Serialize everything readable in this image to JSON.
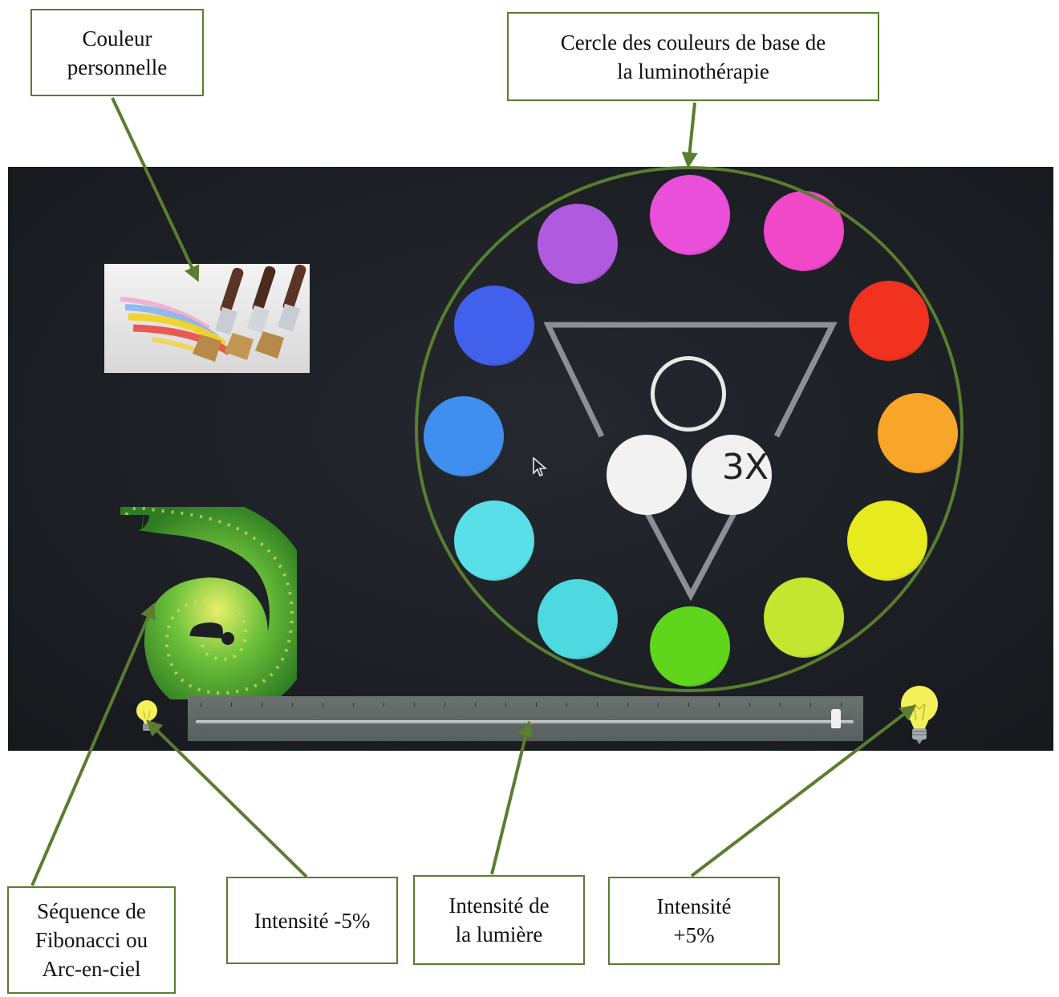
{
  "callouts": {
    "custom_color": "Couleur\npersonnelle",
    "base_circle": "Cercle des couleurs de base de\nla luminothérapie",
    "fibonacci": "Séquence de\nFibonacci ou\nArc-en-ciel",
    "intensity_minus": "Intensité -5%",
    "intensity_level": "Intensité de\nla lumière",
    "intensity_plus": "Intensité\n+5%"
  },
  "color_wheel": {
    "swatches": [
      {
        "name": "magenta",
        "color": "#e94fd8"
      },
      {
        "name": "pink",
        "color": "#f048c9"
      },
      {
        "name": "red",
        "color": "#f0321f"
      },
      {
        "name": "orange",
        "color": "#f9a52a"
      },
      {
        "name": "yellow",
        "color": "#e7ea1e"
      },
      {
        "name": "yellow-green",
        "color": "#c5e631"
      },
      {
        "name": "green",
        "color": "#5fd61c"
      },
      {
        "name": "turquoise",
        "color": "#4dd9df"
      },
      {
        "name": "cyan",
        "color": "#59dfe7"
      },
      {
        "name": "azure",
        "color": "#3e8ff0"
      },
      {
        "name": "blue",
        "color": "#4160ec"
      },
      {
        "name": "violet",
        "color": "#b05bdf"
      }
    ],
    "triangle_center": {
      "label": "3X",
      "white_color": "#f2f2f2",
      "outline_color": "#e8e8e8"
    }
  },
  "intensity_slider": {
    "value_fraction": 0.98
  },
  "icons": {
    "custom_color": "paint-brushes-icon",
    "fibonacci": "fibonacci-spiral-icon",
    "minus": "light-bulb-small-icon",
    "plus": "light-bulb-large-icon",
    "cursor": "mouse-pointer-icon"
  },
  "accent_color": "#5a7d2f"
}
